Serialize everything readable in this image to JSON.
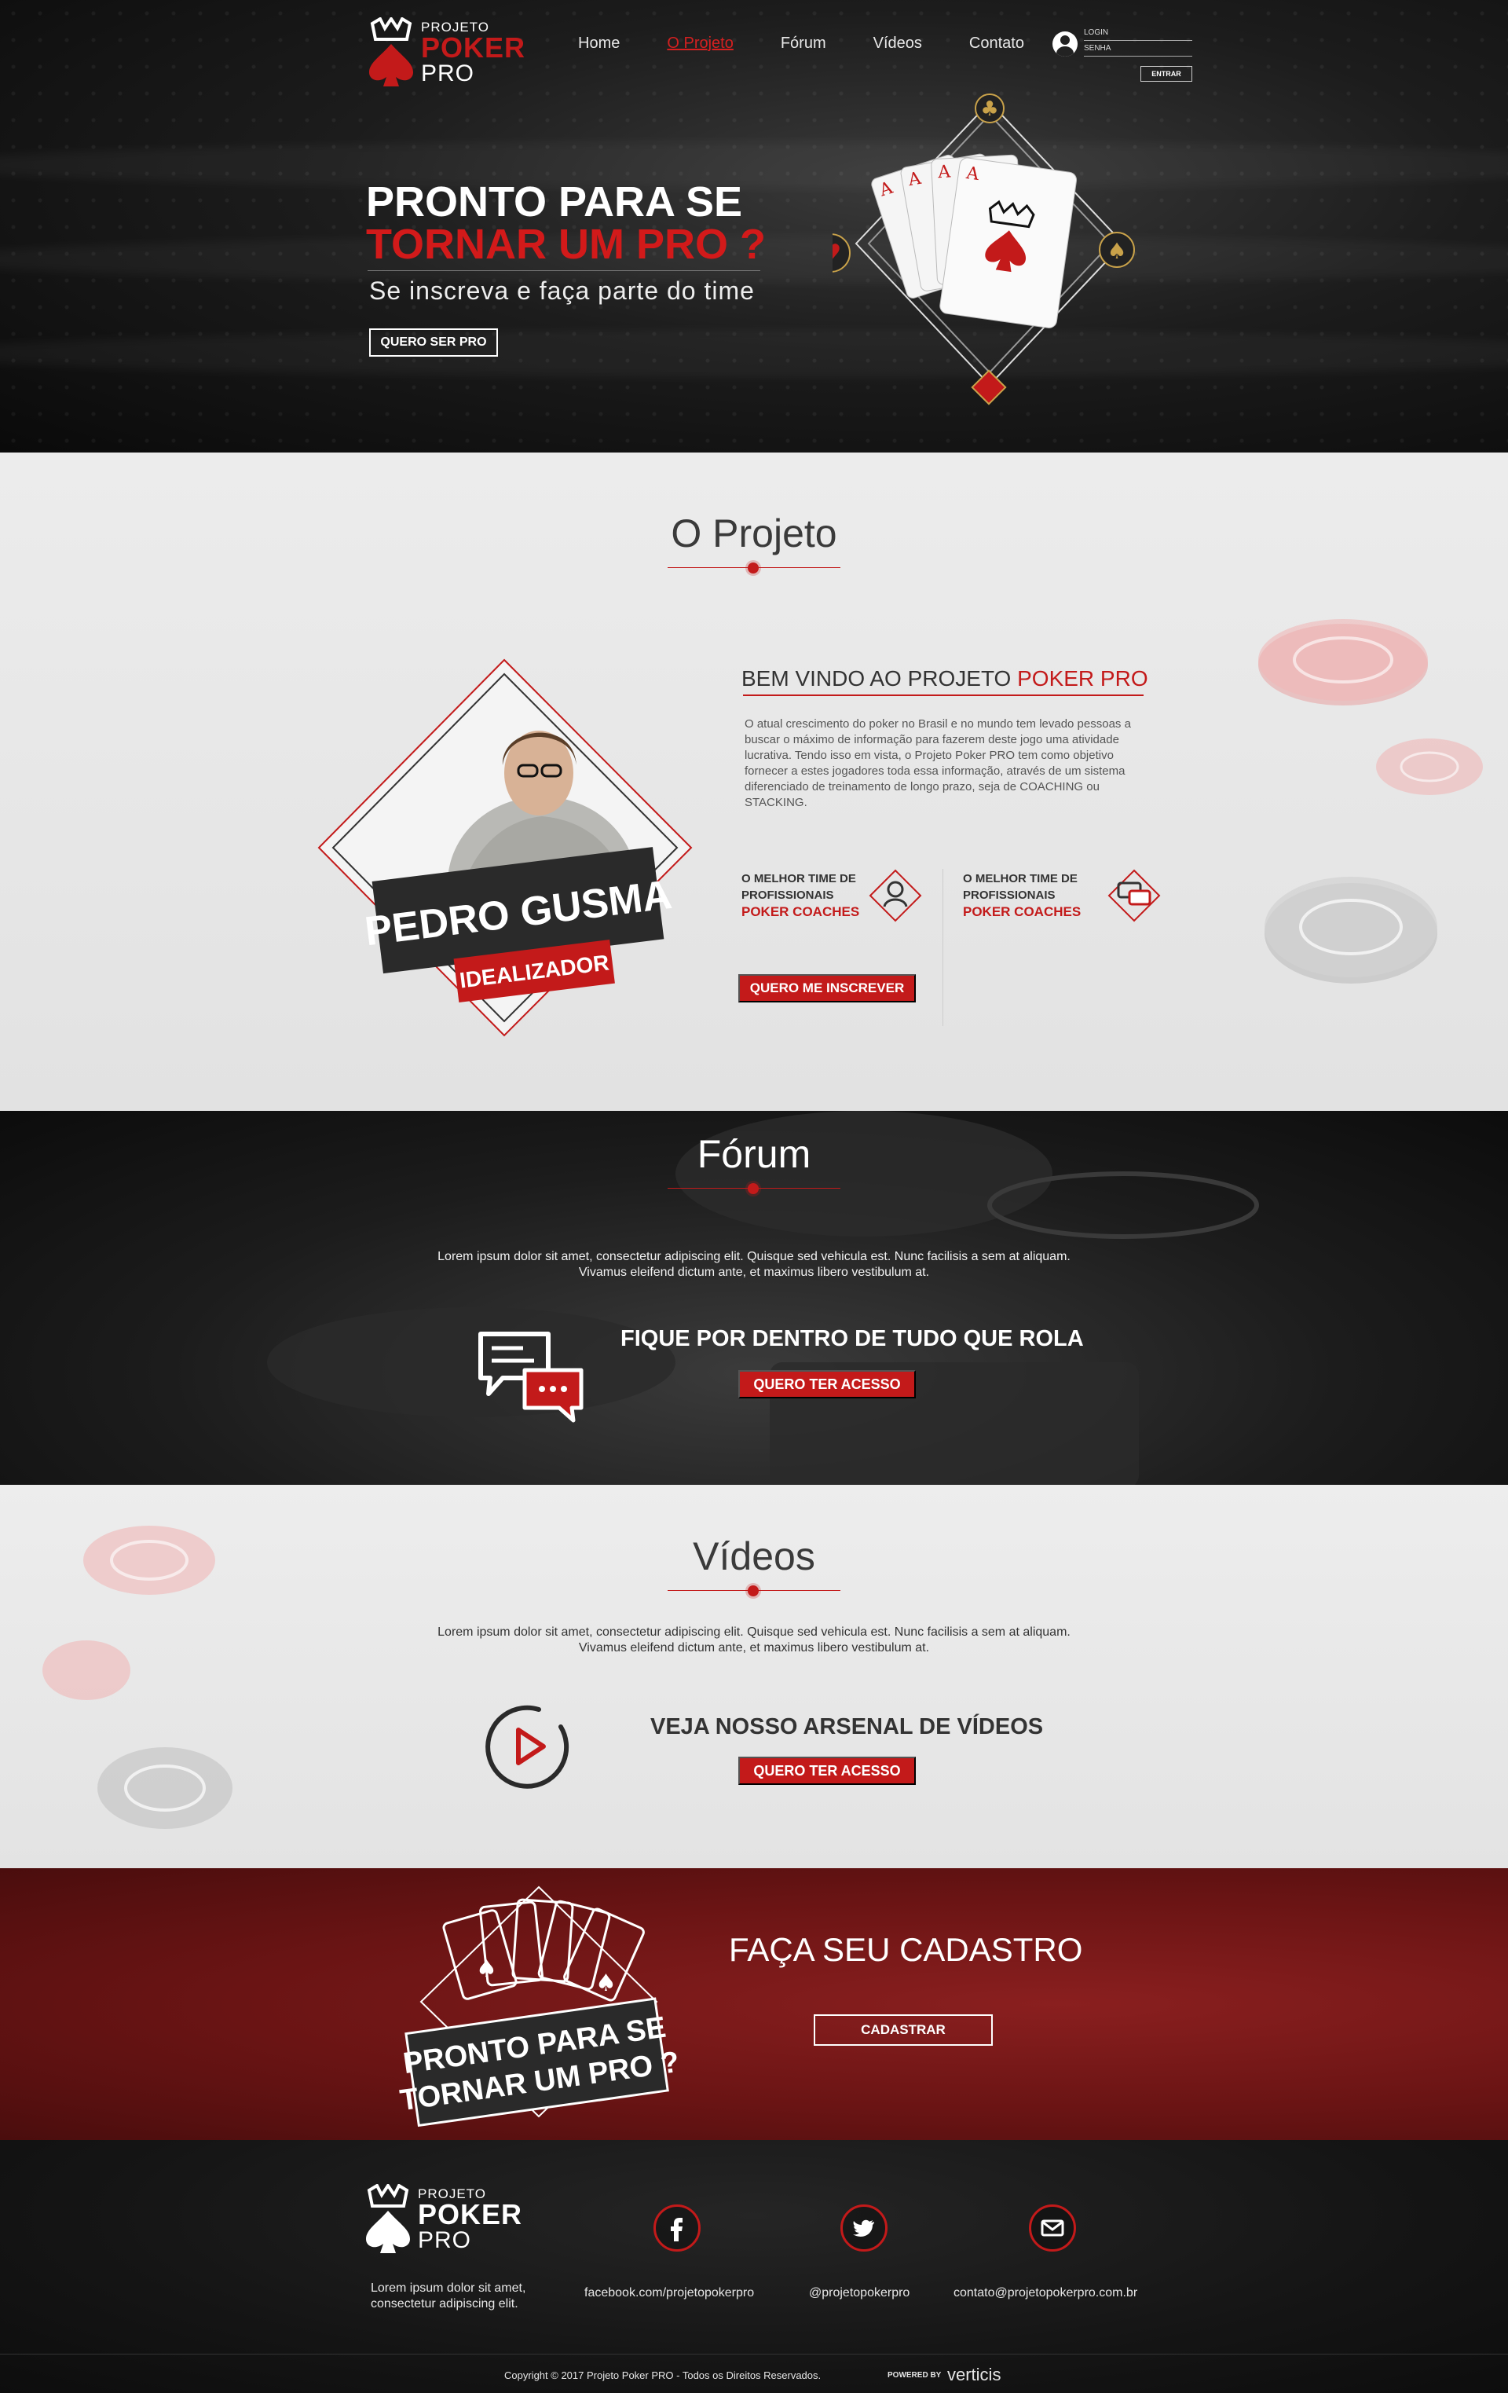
{
  "header": {
    "logo": {
      "line1": "PROJETO",
      "line2": "POKER",
      "line3": "PRO"
    },
    "nav": [
      {
        "label": "Home"
      },
      {
        "label": "O Projeto",
        "active": true
      },
      {
        "label": "Fórum"
      },
      {
        "label": "Vídeos"
      },
      {
        "label": "Contato"
      }
    ],
    "login": {
      "login_label": "LOGIN",
      "password_label": "SENHA",
      "button": "ENTRAR"
    }
  },
  "hero": {
    "line1": "PRONTO PARA SE",
    "line2": "TORNAR UM PRO ?",
    "subtitle": "Se inscreva e faça parte do time",
    "cta": "QUERO SER PRO"
  },
  "projeto": {
    "title": "O Projeto",
    "badge_name": "PEDRO GUSMA",
    "badge_role": "IDEALIZADOR",
    "heading_prefix": "BEM VINDO AO PROJETO ",
    "heading_highlight": "POKER PRO",
    "body": "O atual crescimento do poker no Brasil e no mundo tem levado pessoas a buscar o máximo de informação para fazerem deste jogo uma atividade lucrativa. Tendo isso em vista, o Projeto Poker PRO tem como objetivo fornecer a estes jogadores toda essa informação, através de um sistema diferenciado de treinamento de longo prazo, seja de COACHING ou STACKING.",
    "features": [
      {
        "line1": "O MELHOR TIME DE",
        "line2": "PROFISSIONAIS",
        "highlight": "POKER COACHES",
        "icon": "coach-icon"
      },
      {
        "line1": "O MELHOR TIME DE",
        "line2": "PROFISSIONAIS",
        "highlight": "POKER COACHES",
        "icon": "chat-icon"
      }
    ],
    "cta": "QUERO ME INSCREVER"
  },
  "forum": {
    "title": "Fórum",
    "text_line1": "Lorem ipsum dolor sit amet, consectetur adipiscing elit. Quisque sed vehicula est. Nunc facilisis a sem at aliquam.",
    "text_line2": "Vivamus eleifend dictum ante, et maximus libero vestibulum at.",
    "headline": "FIQUE POR DENTRO DE TUDO QUE ROLA",
    "cta": "QUERO TER ACESSO"
  },
  "videos": {
    "title": "Vídeos",
    "text_line1": "Lorem ipsum dolor sit amet, consectetur adipiscing elit. Quisque sed vehicula est. Nunc facilisis a sem at aliquam.",
    "text_line2": "Vivamus eleifend dictum ante, et maximus libero vestibulum at.",
    "headline": "VEJA NOSSO ARSENAL DE VÍDEOS",
    "cta": "QUERO TER ACESSO"
  },
  "cadastro": {
    "badge_line1": "PRONTO PARA SE",
    "badge_line2": "TORNAR UM PRO ?",
    "title": "FAÇA SEU CADASTRO",
    "cta": "CADASTRAR"
  },
  "footer": {
    "logo": {
      "line1": "PROJETO",
      "line2": "POKER",
      "line3": "PRO"
    },
    "about_line1": "Lorem ipsum dolor sit amet,",
    "about_line2": "consectetur adipiscing elit.",
    "facebook": "facebook.com/projetopokerpro",
    "twitter": "@projetopokerpro",
    "email": "contato@projetopokerpro.com.br",
    "copyright": "Copyright © 2017 Projeto Poker PRO - Todos os Direitos Reservados.",
    "powered_label": "POWERED BY",
    "powered_brand": "verticis"
  },
  "colors": {
    "accent": "#c31a1a",
    "dark": "#111111",
    "light": "#ebebeb",
    "wine": "#6a1414"
  }
}
